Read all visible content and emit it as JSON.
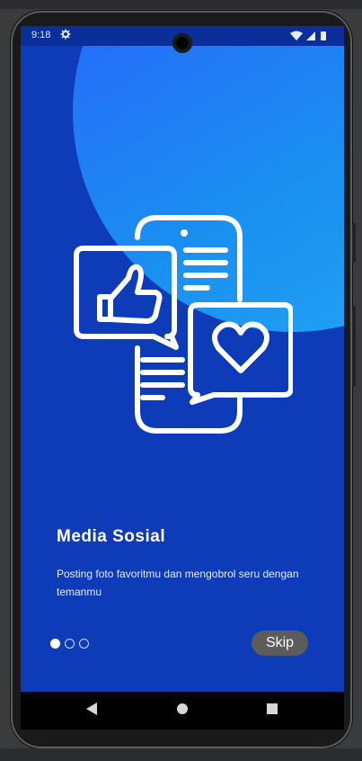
{
  "status": {
    "time": "9:18"
  },
  "onboarding": {
    "title": "Media Sosial",
    "description": "Posting foto favoritmu dan mengobrol seru dengan temanmu",
    "skip_label": "Skip",
    "page_count": 3,
    "current_page": 1
  },
  "colors": {
    "screen_bg": "#0e3cb9",
    "circle": "#1a8ff0",
    "skip_bg": "#5c5c5c"
  },
  "icons": [
    "settings-icon",
    "wifi-icon",
    "signal-icon",
    "battery-icon",
    "social-media-illustration",
    "back-icon",
    "home-icon",
    "recents-icon"
  ]
}
